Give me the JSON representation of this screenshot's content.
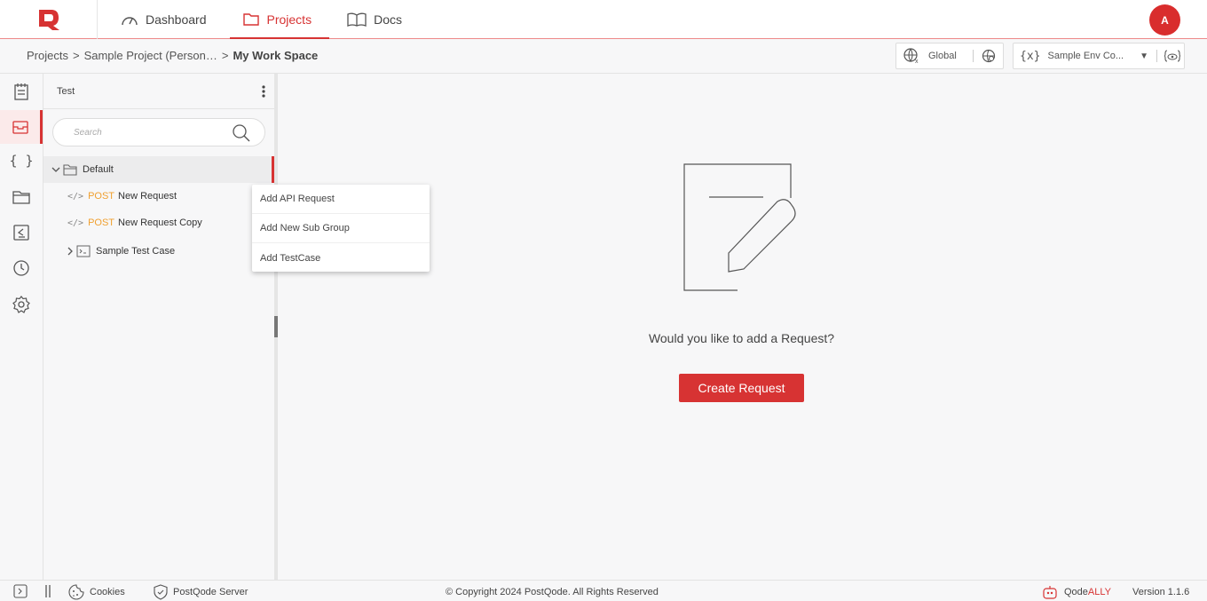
{
  "nav": {
    "items": [
      {
        "label": "Dashboard",
        "icon": "gauge-icon"
      },
      {
        "label": "Projects",
        "icon": "folder-icon"
      },
      {
        "label": "Docs",
        "icon": "book-icon"
      }
    ],
    "avatar": "A",
    "active_color": "#d73333"
  },
  "breadcrumb": {
    "items": [
      "Projects",
      ">",
      "Sample Project (Person…",
      ">"
    ],
    "current": "My Work Space"
  },
  "env": {
    "global_label": "Global",
    "env_selected": "Sample Env Co..."
  },
  "tree": {
    "title": "Test",
    "search_placeholder": "Search",
    "folder": "Default",
    "requests": [
      {
        "method": "POST",
        "name": "New Request"
      },
      {
        "method": "POST",
        "name": "New Request Copy"
      }
    ],
    "testcase": "Sample Test Case"
  },
  "context_menu": [
    "Add API Request",
    "Add New Sub Group",
    "Add TestCase"
  ],
  "main": {
    "prompt": "Would you like to add a Request?",
    "button": "Create Request"
  },
  "footer": {
    "cookies": "Cookies",
    "server": "PostQode Server",
    "copyright": "© Copyright 2024 PostQode. All Rights Reserved",
    "brand_a": "Qode",
    "brand_b": "ALLY",
    "version": "Version 1.1.6"
  }
}
